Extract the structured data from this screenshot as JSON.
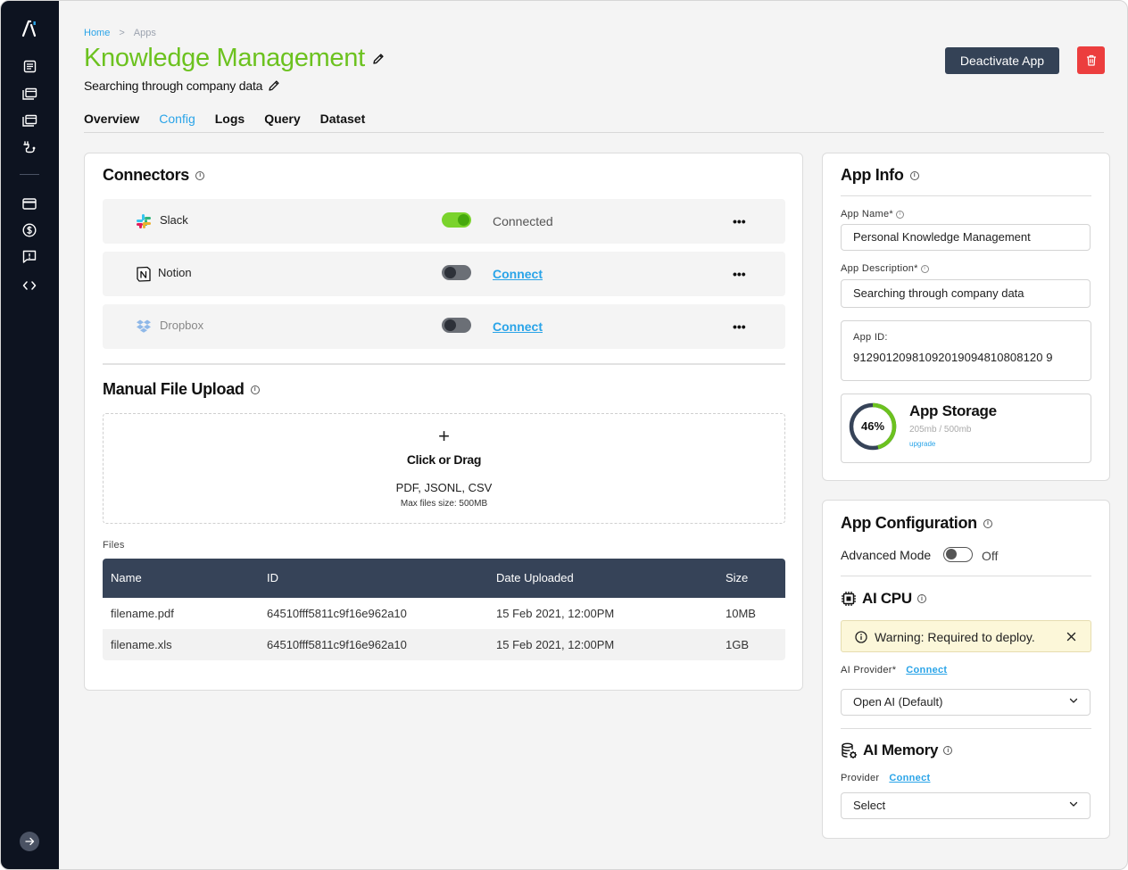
{
  "breadcrumb": {
    "home": "Home",
    "separator": ">",
    "current": "Apps"
  },
  "page": {
    "title": "Knowledge Management",
    "subtitle": "Searching through company data"
  },
  "header": {
    "deactivate_label": "Deactivate App"
  },
  "tabs": [
    {
      "label": "Overview",
      "active": false
    },
    {
      "label": "Config",
      "active": true
    },
    {
      "label": "Logs",
      "active": false
    },
    {
      "label": "Query",
      "active": false
    },
    {
      "label": "Dataset",
      "active": false
    }
  ],
  "connectors": {
    "title": "Connectors",
    "items": [
      {
        "name": "Slack",
        "icon": "slack-icon",
        "enabled": true,
        "status": "Connected",
        "action": ""
      },
      {
        "name": "Notion",
        "icon": "notion-icon",
        "enabled": false,
        "status": "",
        "action": "Connect"
      },
      {
        "name": "Dropbox",
        "icon": "dropbox-icon",
        "enabled": false,
        "status": "",
        "action": "Connect"
      }
    ],
    "more": "•••"
  },
  "upload": {
    "title": "Manual File Upload",
    "plus": "+",
    "cta": "Click or Drag",
    "formats": "PDF, JSONL, CSV",
    "max_size": "Max files size: 500MB"
  },
  "files": {
    "label": "Files",
    "columns": [
      "Name",
      "ID",
      "Date Uploaded",
      "Size"
    ],
    "rows": [
      [
        "filename.pdf",
        "64510fff5811c9f16e962a10",
        "15 Feb 2021, 12:00PM",
        "10MB"
      ],
      [
        "filename.xls",
        "64510fff5811c9f16e962a10",
        "15 Feb 2021, 12:00PM",
        "1GB"
      ]
    ]
  },
  "app_info": {
    "title": "App Info",
    "name_label": "App Name*",
    "name_value": "Personal Knowledge Management",
    "desc_label": "App Description*",
    "desc_value": "Searching through company data",
    "id_label": "App ID:",
    "id_value": "91290120981092019094810808120 9",
    "storage": {
      "title": "App Storage",
      "percent_text": "46%",
      "percent": 46,
      "usage": "205mb / 500mb",
      "upgrade": "upgrade"
    }
  },
  "app_config": {
    "title": "App Configuration",
    "advanced_label": "Advanced Mode",
    "advanced_state": "Off",
    "ai_cpu": {
      "title": "AI CPU",
      "warning": "Warning: Required to deploy.",
      "provider_label": "AI Provider*",
      "provider_link": "Connect",
      "provider_value": "Open AI (Default)"
    },
    "ai_memory": {
      "title": "AI Memory",
      "provider_label": "Provider",
      "provider_link": "Connect",
      "provider_value": "Select"
    }
  },
  "colors": {
    "accent": "#2aa4e8",
    "title_green": "#6cc21f",
    "sidebar": "#0d1320",
    "danger": "#ec3e3e",
    "table_header": "#364358",
    "warning_bg": "#fcf7d9"
  }
}
